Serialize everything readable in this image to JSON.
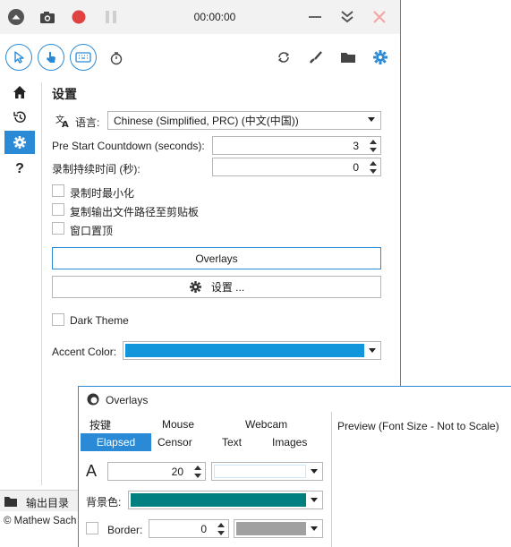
{
  "titlebar": {
    "timer": "00:00:00"
  },
  "colors": {
    "accent": "#2b8ad6",
    "record": "#e04141",
    "close_disabled": "#f5a3a3",
    "accent_swatch": "#1296db",
    "bg_swatch": "#008080",
    "border_swatch": "#a0a0a0"
  },
  "settings": {
    "heading": "设置",
    "language_label": "语言:",
    "language_value": "Chinese (Simplified, PRC) (中文(中国))",
    "countdown_label": "Pre Start Countdown (seconds):",
    "countdown_value": "3",
    "duration_label": "录制持续时间 (秒):",
    "duration_value": "0",
    "checkbox_minimize": "录制时最小化",
    "checkbox_copy_path": "复制输出文件路径至剪贴板",
    "checkbox_topmost": "窗口置顶",
    "overlays_button": "Overlays",
    "settings_button": "设置 ...",
    "dark_theme": "Dark Theme",
    "accent_label": "Accent Color:"
  },
  "footer": {
    "output_folder": "输出目录",
    "copyright": "© Mathew Sach"
  },
  "overlays": {
    "title": "Overlays",
    "tabs_row1": [
      "按键",
      "Mouse",
      "Webcam"
    ],
    "tabs_row2": [
      "Elapsed",
      "Censor",
      "Text",
      "Images"
    ],
    "active_tab": "Elapsed",
    "preview_label": "Preview (Font Size - Not to Scale)",
    "font_size_value": "20",
    "bg_label": "背景色:",
    "border_label": "Border:",
    "border_value": "0"
  }
}
